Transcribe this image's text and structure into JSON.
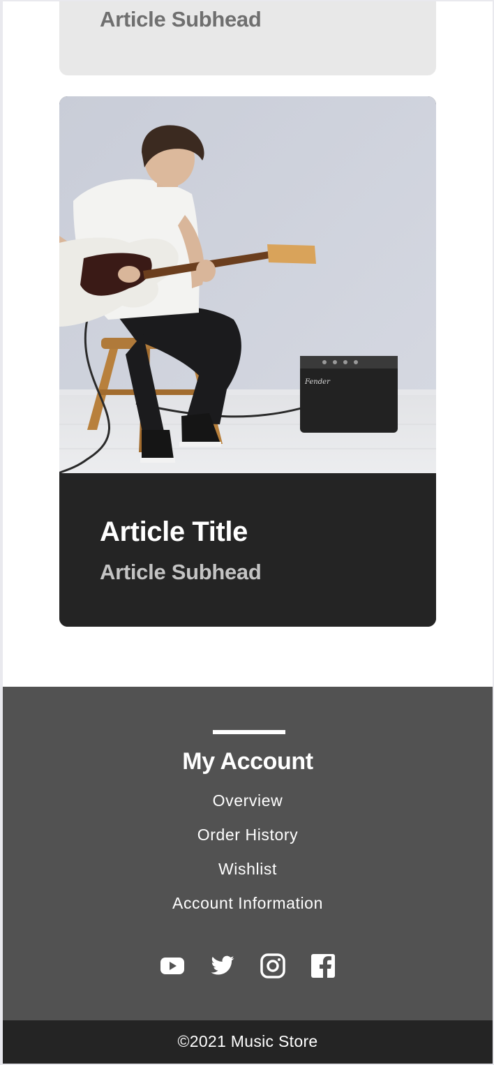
{
  "cards": [
    {
      "subhead": "Article Subhead"
    },
    {
      "title": "Article Title",
      "subhead": "Article Subhead",
      "image_alt": "Man playing electric guitar on a stool next to an amplifier"
    }
  ],
  "footer": {
    "heading": "My Account",
    "links": [
      "Overview",
      "Order History",
      "Wishlist",
      "Account Information"
    ],
    "social": [
      "youtube-icon",
      "twitter-icon",
      "instagram-icon",
      "facebook-icon"
    ],
    "copyright": "©2021 Music Store"
  },
  "colors": {
    "card_top_bg": "#e8e8e8",
    "card_dark_bg": "#242424",
    "footer_bg": "#525252",
    "copyright_bg": "#242424",
    "text_light": "#ffffff"
  }
}
